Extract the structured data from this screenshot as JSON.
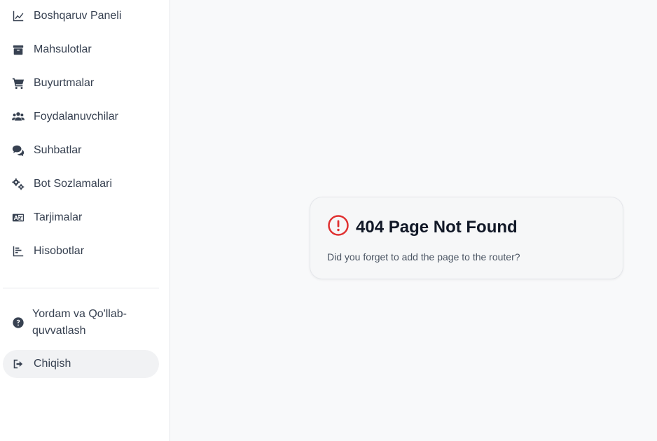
{
  "sidebar": {
    "items": [
      {
        "label": "Boshqaruv Paneli",
        "icon": "chart-line-icon"
      },
      {
        "label": "Mahsulotlar",
        "icon": "box-icon"
      },
      {
        "label": "Buyurtmalar",
        "icon": "cart-icon"
      },
      {
        "label": "Foydalanuvchilar",
        "icon": "users-icon"
      },
      {
        "label": "Suhbatlar",
        "icon": "chat-icon"
      },
      {
        "label": "Bot Sozlamalari",
        "icon": "gears-icon"
      },
      {
        "label": "Tarjimalar",
        "icon": "language-icon"
      },
      {
        "label": "Hisobotlar",
        "icon": "bar-chart-icon"
      }
    ],
    "help_label": "Yordam va Qo'llab-quvvatlash",
    "logout_label": "Chiqish"
  },
  "not_found": {
    "title": "404 Page Not Found",
    "message": "Did you forget to add the page to the router?",
    "icon": "alert-circle-icon",
    "icon_color": "#e03131"
  }
}
